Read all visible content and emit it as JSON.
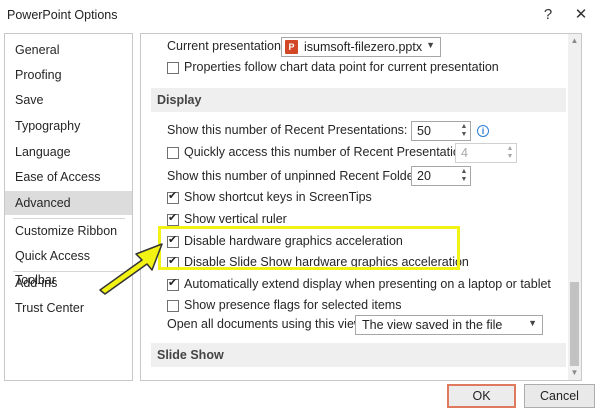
{
  "window": {
    "title": "PowerPoint Options",
    "help_label": "?",
    "close_label": "✕"
  },
  "sidebar": {
    "items": [
      {
        "label": "General"
      },
      {
        "label": "Proofing"
      },
      {
        "label": "Save"
      },
      {
        "label": "Typography"
      },
      {
        "label": "Language"
      },
      {
        "label": "Ease of Access"
      },
      {
        "label": "Advanced",
        "selected": true
      },
      {
        "label": "Customize Ribbon"
      },
      {
        "label": "Quick Access Toolbar"
      },
      {
        "label": "Add-ins"
      },
      {
        "label": "Trust Center"
      }
    ]
  },
  "content": {
    "current_presentation": {
      "label": "Current presentation:",
      "value": "isumsoft-filezero.pptx",
      "icon": "powerpoint-file-icon",
      "icon_letter": "P"
    },
    "chart_props": {
      "label": "Properties follow chart data point for current presentation",
      "checked": false
    },
    "display_header": "Display",
    "recent_presentations": {
      "label": "Show this number of Recent Presentations:",
      "value": "50"
    },
    "quick_access": {
      "label": "Quickly access this number of Recent Presentations:",
      "value": "4",
      "checked": false
    },
    "recent_folders": {
      "label": "Show this number of unpinned Recent Folders:",
      "value": "20"
    },
    "shortcut_keys": {
      "label": "Show shortcut keys in ScreenTips",
      "checked": true
    },
    "vertical_ruler": {
      "label": "Show vertical ruler",
      "checked": true
    },
    "disable_hw_accel": {
      "label": "Disable hardware graphics acceleration",
      "checked": true
    },
    "disable_slideshow_hw_accel": {
      "label": "Disable Slide Show hardware graphics acceleration",
      "checked": true
    },
    "auto_extend": {
      "label": "Automatically extend display when presenting on a laptop or tablet",
      "checked": true
    },
    "presence_flags": {
      "label": "Show presence flags for selected items",
      "checked": false
    },
    "open_docs": {
      "label": "Open all documents using this view",
      "value": "The view saved in the file"
    },
    "slideshow_header": "Slide Show",
    "info_glyph": "i"
  },
  "buttons": {
    "ok": "OK",
    "cancel": "Cancel"
  },
  "colors": {
    "highlight": "#f2f215",
    "arrow_fill": "#f2f215",
    "ok_border": "#e07a5f"
  }
}
